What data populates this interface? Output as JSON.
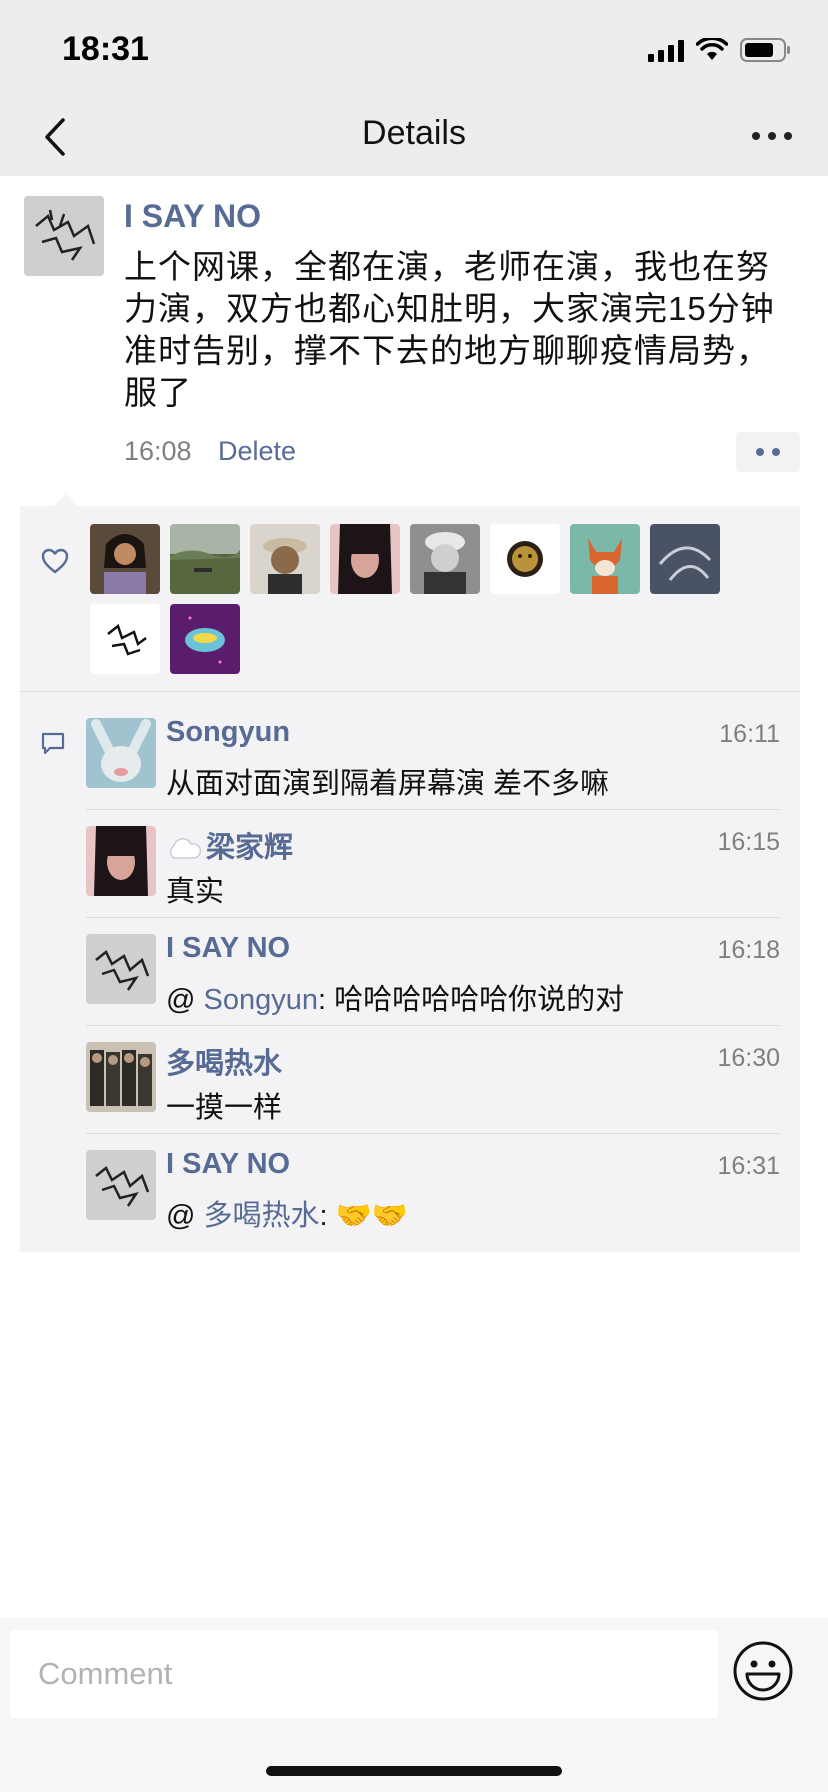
{
  "status_bar": {
    "time": "18:31"
  },
  "nav": {
    "title": "Details"
  },
  "post": {
    "author": "I SAY NO",
    "text": "上个网课，全都在演，老师在演，我也在努力演，双方也都心知肚明，大家演完15分钟准时告别，撑不下去的地方聊聊疫情局势，服了",
    "time": "16:08",
    "delete_label": "Delete"
  },
  "likes": {
    "avatars": [
      "woman-portrait-avatar",
      "field-landscape-avatar",
      "cat-with-hat-avatar",
      "pink-girl-illustration-avatar",
      "bw-child-photo-avatar",
      "gold-face-avatar",
      "fox-cartoon-avatar",
      "dark-blue-abstract-avatar",
      "ink-sketch-avatar",
      "purple-galaxy-avatar"
    ]
  },
  "comments": [
    {
      "name": "Songyun",
      "time": "16:11",
      "text": "从面对面演到隔着屏幕演 差不多嘛",
      "mention": "",
      "avatar": "bunny-rain-avatar"
    },
    {
      "name": "梁家辉",
      "time": "16:15",
      "text": "真实",
      "mention": "",
      "avatar": "pink-girl-illustration-avatar",
      "prefix_icon": "cloud-emoji"
    },
    {
      "name": "I SAY NO",
      "time": "16:18",
      "text": ": 哈哈哈哈哈哈你说的对",
      "mention": "Songyun",
      "avatar": "ink-sketch-avatar"
    },
    {
      "name": "多喝热水",
      "time": "16:30",
      "text": "一摸一样",
      "mention": "",
      "avatar": "band-photo-avatar"
    },
    {
      "name": "I SAY NO",
      "time": "16:31",
      "text": ": 🤝🤝",
      "mention": "多喝热水",
      "avatar": "ink-sketch-avatar"
    }
  ],
  "comment_box": {
    "placeholder": "Comment"
  },
  "colors": {
    "link": "#576b95",
    "bar_bg": "#ededed",
    "panel_bg": "#f3f3f5"
  }
}
